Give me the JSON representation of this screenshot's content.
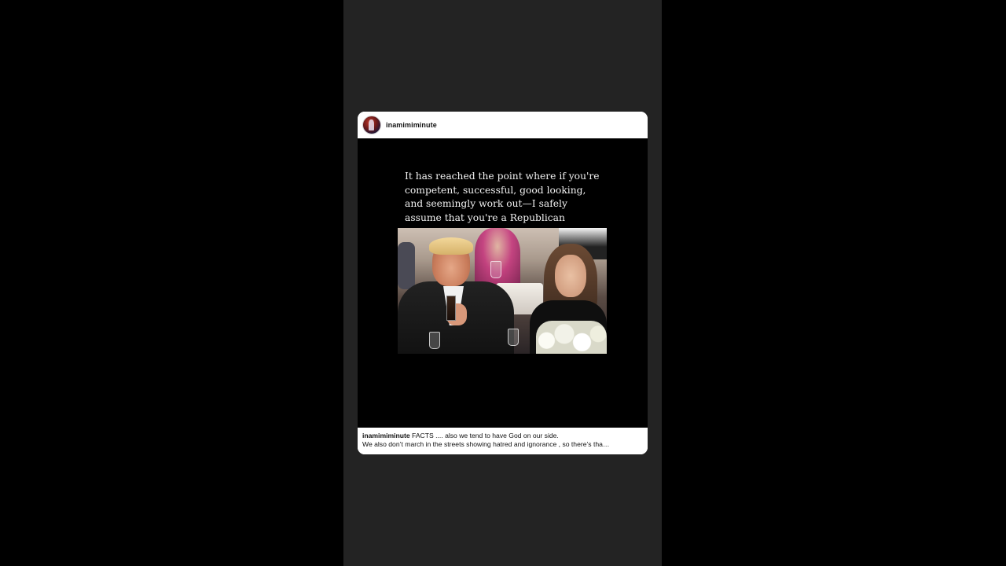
{
  "post": {
    "username": "inamimiminute",
    "caption": {
      "username": "inamimiminute",
      "line1": "FACTS .... also we tend to have God on our side.",
      "line2": "We also don’t march in the streets showing hatred and ignorance , so there’s tha…"
    },
    "meme_text": "It has reached the point where if you're\ncompetent, successful, good looking,\nand seemingly work out—I safely\nassume that you're a Republican"
  },
  "colors": {
    "page_background": "#000000",
    "phone_background": "#232323",
    "card_background": "#ffffff",
    "media_background": "#000000",
    "meme_text": "#f2f2f2"
  },
  "icons": {
    "avatar": "profile-avatar"
  }
}
